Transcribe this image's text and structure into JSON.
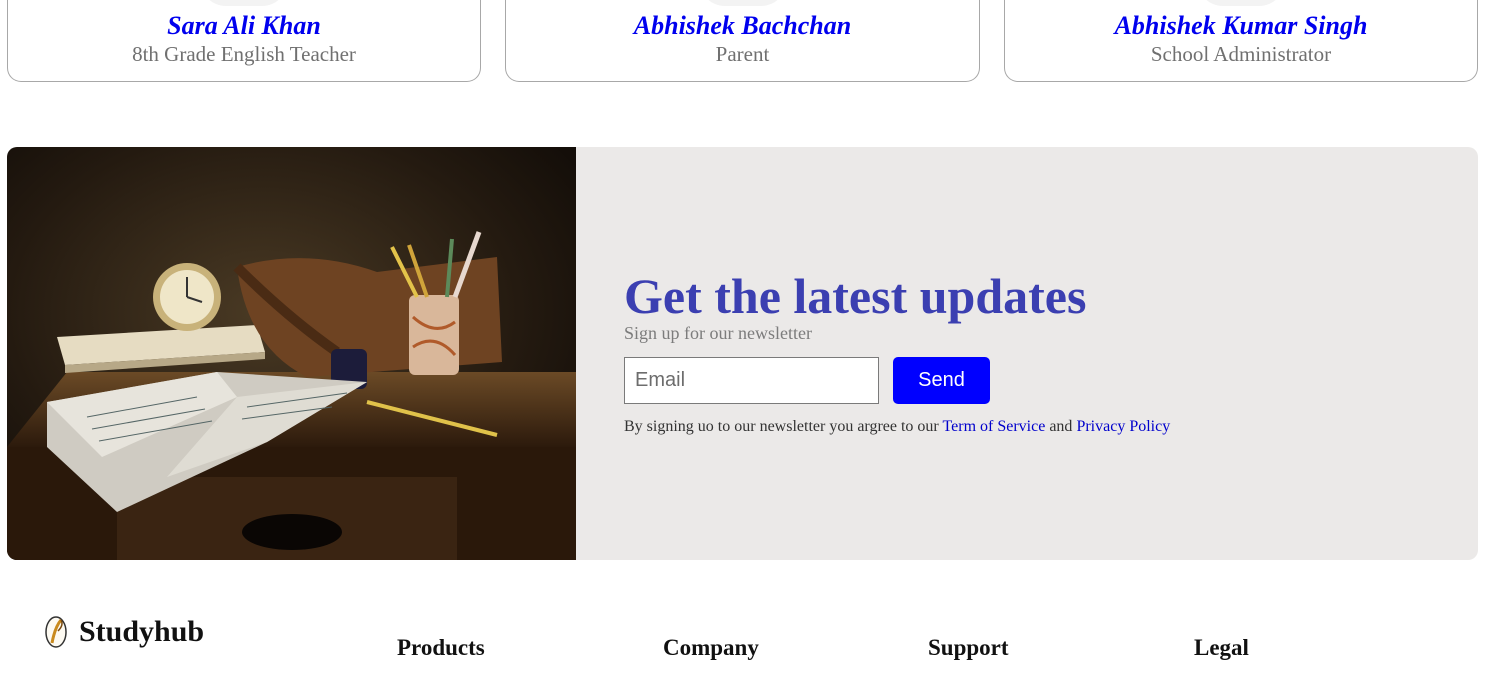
{
  "testimonials": [
    {
      "name": "Sara Ali Khan",
      "role": "8th Grade English Teacher"
    },
    {
      "name": "Abhishek Bachchan",
      "role": "Parent"
    },
    {
      "name": "Abhishek Kumar Singh",
      "role": "School Administrator"
    }
  ],
  "newsletter": {
    "title": "Get the latest updates",
    "subtitle": "Sign up for our newsletter",
    "email_placeholder": "Email",
    "email_value": "",
    "send_label": "Send",
    "legal_prefix": "By signing uo to our newsletter you argree to our",
    "terms_link": "Term of Service",
    "and_text": "and",
    "privacy_link": "Privacy Policy",
    "photo_icon": "desk-with-books-and-clock-photo"
  },
  "footer": {
    "brand": "Studyhub",
    "brand_icon": "quill-icon",
    "columns": [
      "Products",
      "Company",
      "Support",
      "Legal"
    ]
  },
  "colors": {
    "link": "#0000ee",
    "accent_title": "#3b3fb1",
    "button": "#0000ff",
    "panel_bg": "#ebe9e8"
  }
}
